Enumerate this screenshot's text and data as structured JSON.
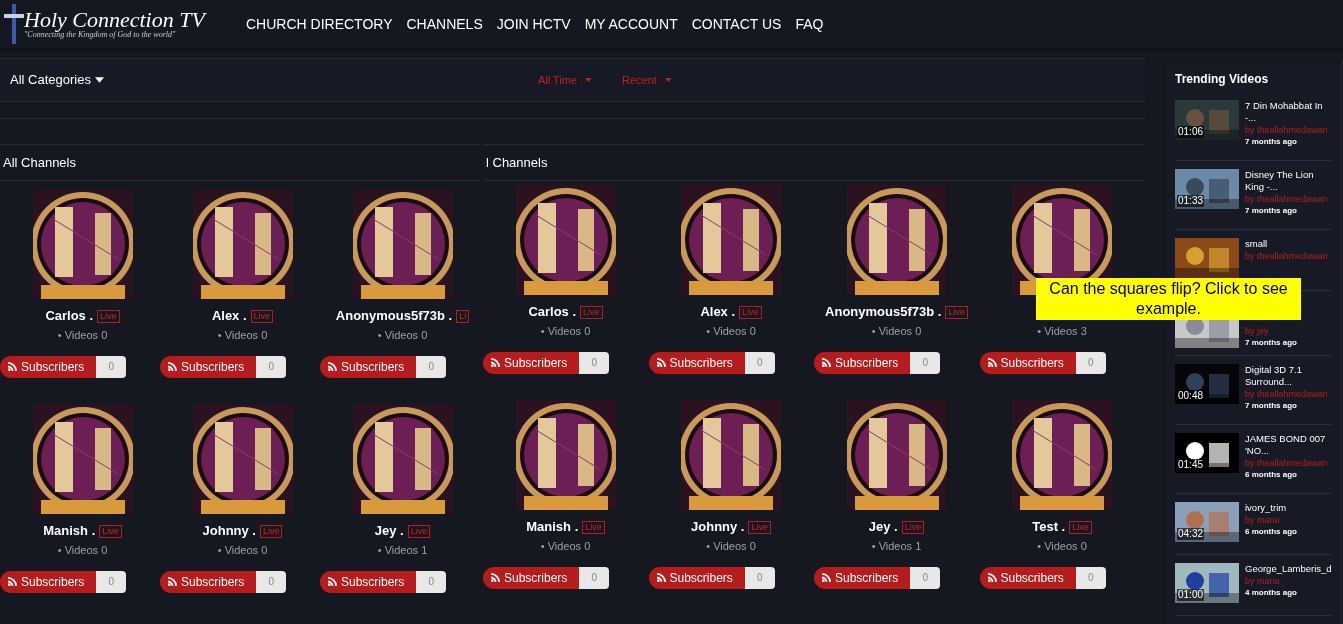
{
  "logo": {
    "title": "Holy Connection TV",
    "tagline": "\"Connecting the Kingdom of God to the world\""
  },
  "nav": [
    "CHURCH DIRECTORY",
    "CHANNELS",
    "JOIN HCTV",
    "MY ACCOUNT",
    "CONTACT US",
    "FAQ"
  ],
  "filters": {
    "category": "All Categories",
    "sorts": [
      "All Time",
      "Recent"
    ]
  },
  "panels": [
    {
      "heading": "All Channels",
      "channels": [
        {
          "name": "Carlos .",
          "badge": "Live",
          "videos": "• Videos 0",
          "button": "Subscribers",
          "count": "0"
        },
        {
          "name": "Alex .",
          "badge": "Live",
          "videos": "• Videos 0",
          "button": "Subscribers",
          "count": "0"
        },
        {
          "name": "Anonymous5f73b .",
          "badge": "Li",
          "videos": "• Videos 0",
          "button": "Subscribers",
          "count": "0"
        },
        {
          "name": "Manish .",
          "badge": "Live",
          "videos": "• Videos 0",
          "button": "Subscribers",
          "count": "0"
        },
        {
          "name": "Johnny .",
          "badge": "Live",
          "videos": "• Videos 0",
          "button": "Subscribers",
          "count": "0"
        },
        {
          "name": "Jey .",
          "badge": "Live",
          "videos": "• Videos 1",
          "button": "Subscribers",
          "count": "0"
        }
      ]
    },
    {
      "heading": "l Channels",
      "channels": [
        {
          "name": "Carlos .",
          "badge": "Live",
          "videos": "• Videos 0",
          "button": "Subscribers",
          "count": "0"
        },
        {
          "name": "Alex .",
          "badge": "Live",
          "videos": "• Videos 0",
          "button": "Subscribers",
          "count": "0"
        },
        {
          "name": "Anonymous5f73b .",
          "badge": "Live",
          "videos": "• Videos 0",
          "button": "Subscribers",
          "count": "0"
        },
        {
          "videos": "• Videos 3",
          "button": "Subscribers",
          "count": "0"
        },
        {
          "name": "Manish .",
          "badge": "Live",
          "videos": "• Videos 0",
          "button": "Subscribers",
          "count": "0"
        },
        {
          "name": "Johnny .",
          "badge": "Live",
          "videos": "• Videos 0",
          "button": "Subscribers",
          "count": "0"
        },
        {
          "name": "Jey .",
          "badge": "Live",
          "videos": "• Videos 1",
          "button": "Subscribers",
          "count": "0"
        },
        {
          "name": "Test .",
          "badge": "Live",
          "videos": "• Videos 0",
          "button": "Subscribers",
          "count": "0"
        }
      ]
    }
  ],
  "tooltip": "Can the squares flip? Click to see example.",
  "trending": {
    "title": "Trending Videos",
    "videos": [
      {
        "title": "7 Din Mohabbat In -...",
        "by": "by",
        "author": "theallahmedawan",
        "time": "7 months ago",
        "duration": "01:06"
      },
      {
        "title": "Disney The Lion King -...",
        "by": "by",
        "author": "theallahmedawan",
        "time": "7 months ago",
        "duration": "01:33"
      },
      {
        "title": "small",
        "by": "by",
        "author": "theallahmedawan"
      },
      {
        "by": "by",
        "author": "jey",
        "time": "7 months ago"
      },
      {
        "title": "Digital 3D 7.1 Surround...",
        "by": "by",
        "author": "theallahmedawan",
        "time": "7 months ago",
        "duration": "00:48"
      },
      {
        "title": "JAMES BOND 007 'NO...",
        "by": "by",
        "author": "theallahmedawan",
        "time": "6 months ago",
        "duration": "01:45"
      },
      {
        "title": "ivory_trim",
        "by": "by",
        "author": "maria",
        "time": "6 months ago",
        "duration": "04:32"
      },
      {
        "title": "George_Lamberis_d",
        "by": "by",
        "author": "maria",
        "time": "4 months ago",
        "duration": "01:00"
      }
    ]
  }
}
